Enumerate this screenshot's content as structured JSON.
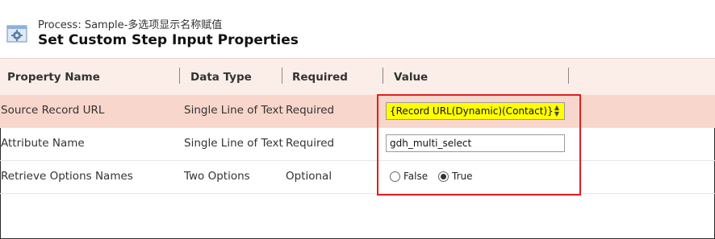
{
  "header": {
    "process_label": "Process: Sample-多选项显示名称赋值",
    "title": "Set Custom Step Input Properties",
    "icon": "settings-window-icon"
  },
  "columns": {
    "property_name": "Property Name",
    "data_type": "Data Type",
    "required": "Required",
    "value": "Value"
  },
  "rows": [
    {
      "property_name": "Source Record URL",
      "data_type": "Single Line of Text",
      "required": "Required",
      "value": "{Record URL(Dynamic)(Contact)}"
    },
    {
      "property_name": "Attribute Name",
      "data_type": "Single Line of Text",
      "required": "Required",
      "value": "gdh_multi_select"
    },
    {
      "property_name": "Retrieve Options Names",
      "data_type": "Two Options",
      "required": "Optional",
      "options": [
        "False",
        "True"
      ],
      "selected": "True"
    }
  ],
  "colors": {
    "header_band": "#fbeee8",
    "selected_row": "#f8d6cb",
    "dynamic_value": "#ffff00",
    "highlight_box": "#e02020"
  }
}
